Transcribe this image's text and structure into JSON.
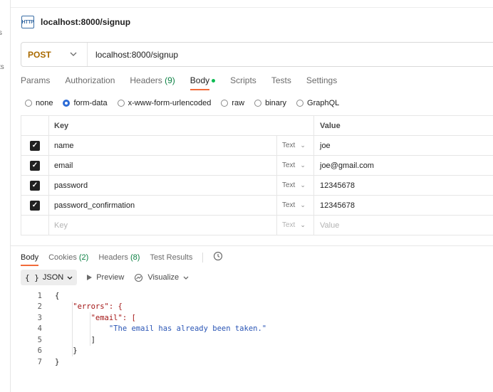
{
  "left_rail": {
    "text1": "s",
    "text2": "ts"
  },
  "request": {
    "title": "localhost:8000/signup",
    "icon": "http-icon",
    "icon_text": "HTTP",
    "method": "POST",
    "url": "localhost:8000/signup",
    "tabs": [
      {
        "label": "Params",
        "count": ""
      },
      {
        "label": "Authorization",
        "count": ""
      },
      {
        "label": "Headers",
        "count": "(9)"
      },
      {
        "label": "Body",
        "count": ""
      },
      {
        "label": "Scripts",
        "count": ""
      },
      {
        "label": "Tests",
        "count": ""
      },
      {
        "label": "Settings",
        "count": ""
      }
    ],
    "active_tab": "Body",
    "body_types": [
      "none",
      "form-data",
      "x-www-form-urlencoded",
      "raw",
      "binary",
      "GraphQL"
    ],
    "selected_body_type": "form-data",
    "table": {
      "headers": {
        "key": "Key",
        "value": "Value"
      },
      "rows": [
        {
          "checked": true,
          "key": "name",
          "type": "Text",
          "value": "joe"
        },
        {
          "checked": true,
          "key": "email",
          "type": "Text",
          "value": "joe@gmail.com"
        },
        {
          "checked": true,
          "key": "password",
          "type": "Text",
          "value": "12345678"
        },
        {
          "checked": true,
          "key": "password_confirmation",
          "type": "Text",
          "value": "12345678"
        }
      ],
      "placeholder": {
        "key": "Key",
        "type": "Text",
        "value": "Value"
      }
    }
  },
  "response": {
    "tabs": [
      {
        "label": "Body",
        "count": ""
      },
      {
        "label": "Cookies",
        "count": "(2)"
      },
      {
        "label": "Headers",
        "count": "(8)"
      },
      {
        "label": "Test Results",
        "count": ""
      }
    ],
    "active_tab": "Body",
    "format_braces": "{ }",
    "format": "JSON",
    "preview_label": "Preview",
    "visualize_label": "Visualize",
    "code_lines": [
      {
        "n": "1",
        "text": "{"
      },
      {
        "n": "2",
        "text": "    \"errors\": {"
      },
      {
        "n": "3",
        "text": "        \"email\": ["
      },
      {
        "n": "4",
        "text": "            \"The email has already been taken.\""
      },
      {
        "n": "5",
        "text": "        ]"
      },
      {
        "n": "6",
        "text": "    }"
      },
      {
        "n": "7",
        "text": "}"
      }
    ]
  },
  "colors": {
    "method": "#a96a00",
    "active_underline": "#f26b3a",
    "count_green": "#0b8043",
    "json_key": "#a31515",
    "json_string": "#2a55b5"
  }
}
